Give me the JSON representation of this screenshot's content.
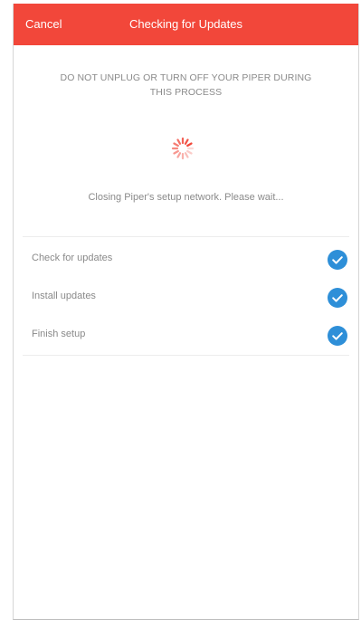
{
  "colors": {
    "accent": "#f2473a",
    "check": "#2e8fd8",
    "spinner": "#f2473a"
  },
  "header": {
    "cancel_label": "Cancel",
    "title": "Checking for Updates"
  },
  "warning": {
    "line1": "DO NOT UNPLUG OR TURN OFF YOUR PIPER DURING",
    "line2": "THIS PROCESS"
  },
  "spinner": {
    "icon": "spinner-icon"
  },
  "status": {
    "text": "Closing Piper's setup network. Please wait..."
  },
  "steps": [
    {
      "label": "Check for updates",
      "icon": "check-circle-icon",
      "done": true
    },
    {
      "label": "Install updates",
      "icon": "check-circle-icon",
      "done": true
    },
    {
      "label": "Finish setup",
      "icon": "check-circle-icon",
      "done": true
    }
  ]
}
